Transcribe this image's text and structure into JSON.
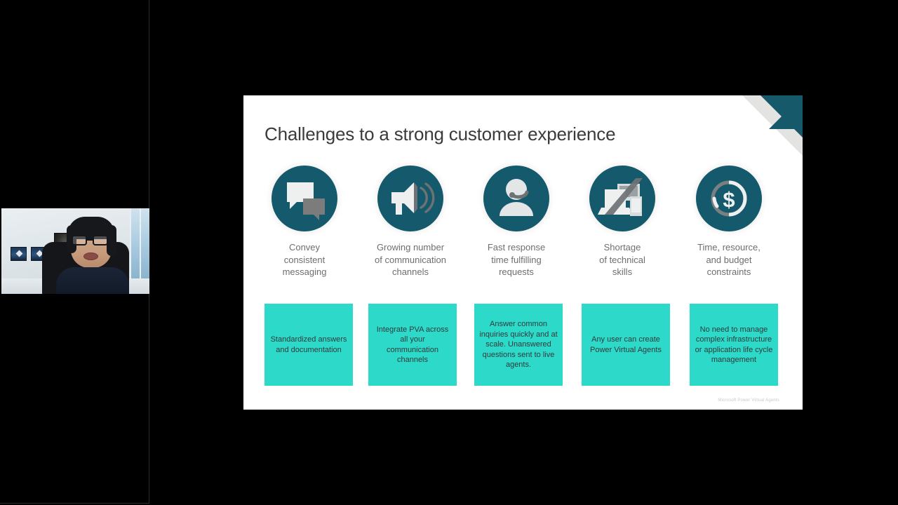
{
  "meeting": {
    "participant_video": {
      "name": "participant-webcam",
      "description": "Person with glasses speaking on webcam in an office"
    }
  },
  "slide": {
    "title": "Challenges to a strong customer experience",
    "footer": "Microsoft Power Virtual Agents",
    "accent_teal": "#145a6c",
    "accent_turquoise": "#2ddac9",
    "title_color": "#3b3b3b",
    "caption_color": "#6e6e6e",
    "columns": [
      {
        "icon": "chat-bubbles-icon",
        "caption": "Convey\nconsistent\nmessaging",
        "box": "Standardized answers and documentation"
      },
      {
        "icon": "megaphone-icon",
        "caption": "Growing number\nof communication\nchannels",
        "box": "Integrate PVA across all your communication channels"
      },
      {
        "icon": "agent-headset-icon",
        "caption": "Fast response\ntime fulfilling\nrequests",
        "box": "Answer common inquiries quickly and at scale. Unanswered questions sent to live agents."
      },
      {
        "icon": "devices-icon",
        "caption": "Shortage\nof technical\nskills",
        "box": "Any user can create Power Virtual Agents"
      },
      {
        "icon": "dollar-circle-icon",
        "caption": "Time, resource,\nand budget\nconstraints",
        "box": "No need to manage complex infrastructure or application life cycle management"
      }
    ]
  }
}
